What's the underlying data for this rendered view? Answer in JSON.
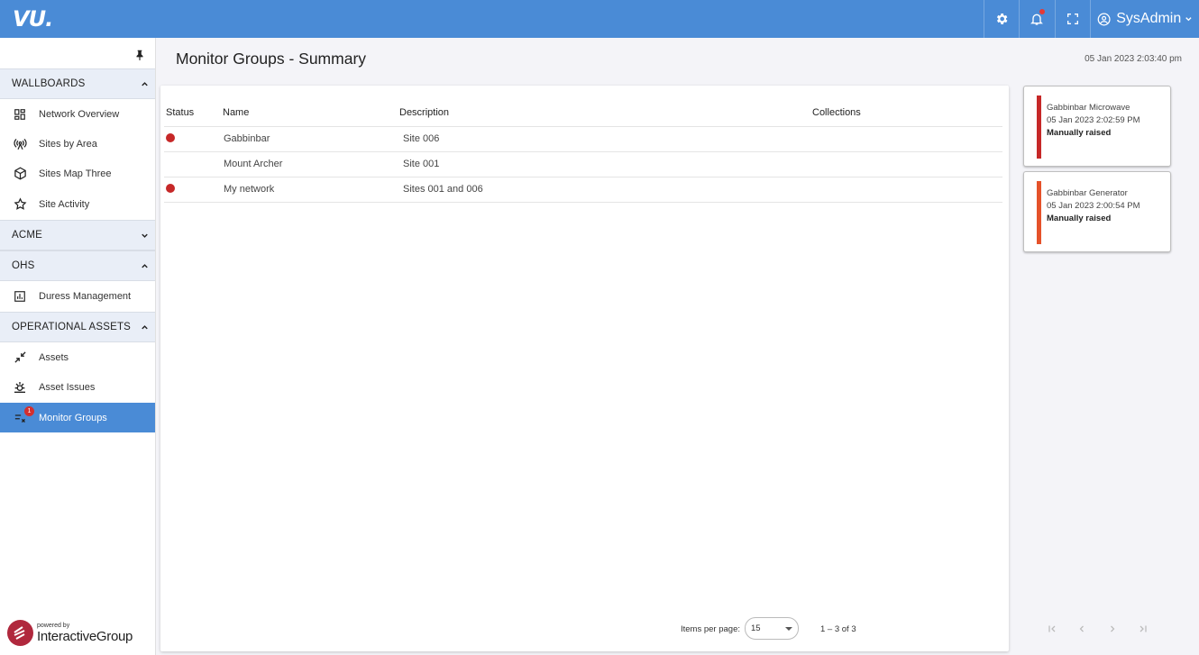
{
  "app": {
    "logo_text": "VU."
  },
  "topbar": {
    "user_name": "SysAdmin"
  },
  "sidebar": {
    "sections": [
      {
        "label": "WALLBOARDS",
        "expanded": true
      },
      {
        "label": "ACME",
        "expanded": false
      },
      {
        "label": "OHS",
        "expanded": true
      },
      {
        "label": "OPERATIONAL ASSETS",
        "expanded": true
      }
    ],
    "items": [
      {
        "label": "Network Overview",
        "icon": "dashboard-icon"
      },
      {
        "label": "Sites by Area",
        "icon": "antenna-icon"
      },
      {
        "label": "Sites Map Three",
        "icon": "cube-icon"
      },
      {
        "label": "Site Activity",
        "icon": "star-icon"
      },
      {
        "label": "Duress Management",
        "icon": "chart-box-icon"
      },
      {
        "label": "Assets",
        "icon": "compress-icon"
      },
      {
        "label": "Asset Issues",
        "icon": "bug-icon"
      },
      {
        "label": "Monitor Groups",
        "icon": "list-check-icon",
        "badge": "1",
        "active": true
      }
    ],
    "powered_by_small": "powered by",
    "powered_by_brand": "InteractiveGroup"
  },
  "header": {
    "title": "Monitor Groups - Summary",
    "timestamp": "05 Jan 2023 2:03:40 pm"
  },
  "table": {
    "columns": [
      "Status",
      "Name",
      "Description",
      "Collections"
    ],
    "rows": [
      {
        "status": "alarm",
        "name": "Gabbinbar",
        "description": "Site 006",
        "collections": ""
      },
      {
        "status": "",
        "name": "Mount Archer",
        "description": "Site 001",
        "collections": ""
      },
      {
        "status": "alarm",
        "name": "My network",
        "description": "Sites 001 and 006",
        "collections": ""
      }
    ]
  },
  "paginator": {
    "items_per_page_label": "Items per page:",
    "items_per_page": "15",
    "range": "1 – 3 of 3"
  },
  "alerts": [
    {
      "title": "Gabbinbar Microwave",
      "time": "05 Jan 2023 2:02:59 PM",
      "note": "Manually raised",
      "color": "#c62828"
    },
    {
      "title": "Gabbinbar Generator",
      "time": "05 Jan 2023 2:00:54 PM",
      "note": "Manually raised",
      "color": "#e5522a"
    }
  ],
  "colors": {
    "primary": "#4a8bd6",
    "alarm": "#c62828"
  }
}
